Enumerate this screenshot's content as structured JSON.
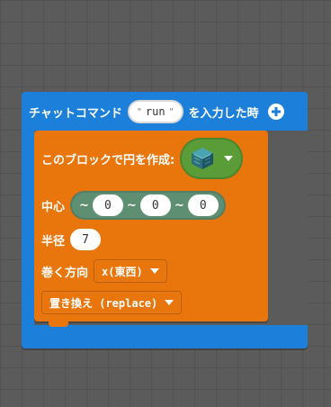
{
  "chat_block": {
    "label_before": "チャットコマンド",
    "command_value": "run",
    "label_after": "を入力した時",
    "add_icon": "plus-circle-icon",
    "color": "#1c7fd9"
  },
  "fill_block": {
    "title": "このブロックで円を作成:",
    "block_picker_icon": "prismarine-block-icon",
    "center_label": "中心",
    "position": {
      "tilde": "~",
      "x": "0",
      "y": "0",
      "z": "0"
    },
    "radius_label": "半径",
    "radius_value": "7",
    "orientation_label": "巻く方向",
    "orientation_value": "x(東西)",
    "operation_value": "置き換え (replace)",
    "color": "#e8760c"
  }
}
